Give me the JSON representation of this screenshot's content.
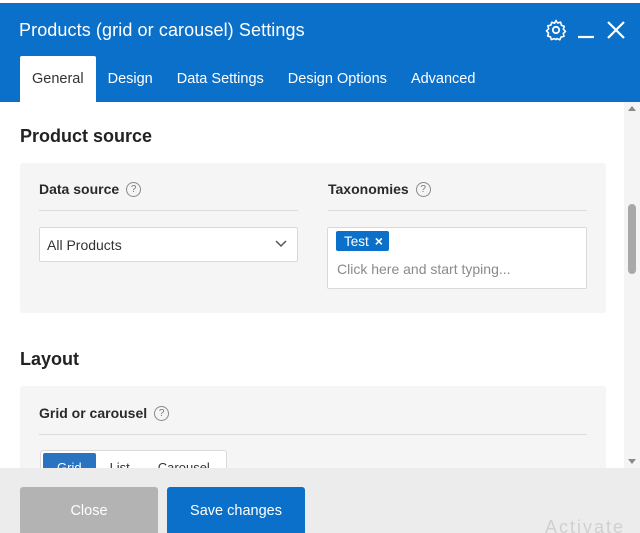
{
  "window": {
    "title": "Products (grid or carousel) Settings",
    "icons": [
      "gear-icon",
      "minimize-icon",
      "close-icon"
    ]
  },
  "tabs": [
    {
      "label": "General",
      "active": true
    },
    {
      "label": "Design",
      "active": false
    },
    {
      "label": "Data Settings",
      "active": false
    },
    {
      "label": "Design Options",
      "active": false
    },
    {
      "label": "Advanced",
      "active": false
    }
  ],
  "product_source": {
    "heading": "Product source",
    "data_source": {
      "label": "Data source",
      "help": "?",
      "selected": "All Products"
    },
    "taxonomies": {
      "label": "Taxonomies",
      "help": "?",
      "tags": [
        {
          "label": "Test",
          "remove": "×"
        }
      ],
      "placeholder": "Click here and start typing..."
    }
  },
  "layout": {
    "heading": "Layout",
    "grid_or_carousel": {
      "label": "Grid or carousel",
      "help": "?",
      "options": [
        {
          "label": "Grid",
          "active": true
        },
        {
          "label": "List",
          "active": false
        },
        {
          "label": "Carousel",
          "active": false
        }
      ]
    }
  },
  "footer": {
    "close_label": "Close",
    "save_label": "Save changes"
  },
  "watermark": "Activate",
  "colors": {
    "primary": "#0b70c9",
    "close_button": "#b3b3b3",
    "card_bg": "#f5f5f5"
  }
}
